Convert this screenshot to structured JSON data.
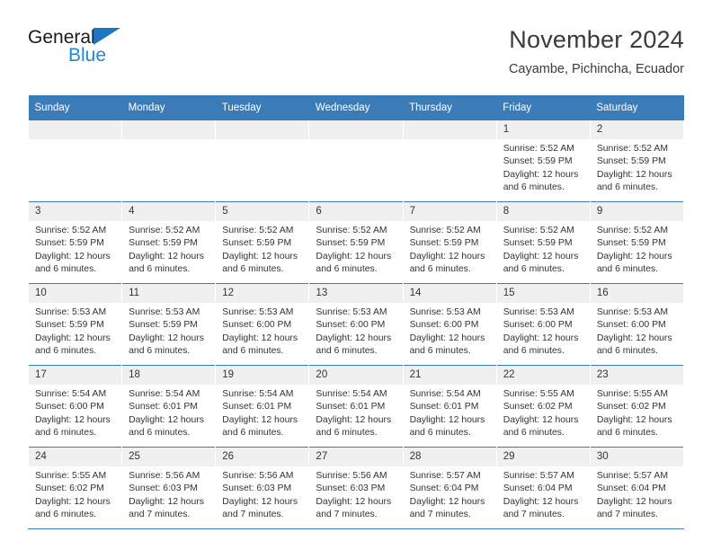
{
  "brand": {
    "name_top": "General",
    "name_bottom": "Blue",
    "triangle_icon": "brand-triangle-icon",
    "accent_color": "#1f76c0",
    "secondary_color": "#2287d6"
  },
  "header": {
    "title": "November 2024",
    "subtitle": "Cayambe, Pichincha, Ecuador"
  },
  "calendar": {
    "header_background": "#3b7cb8",
    "daynum_background": "#f0f0f0",
    "weekdays": [
      "Sunday",
      "Monday",
      "Tuesday",
      "Wednesday",
      "Thursday",
      "Friday",
      "Saturday"
    ],
    "labels": {
      "sunrise": "Sunrise:",
      "sunset": "Sunset:",
      "daylight": "Daylight:"
    },
    "weeks": [
      [
        {
          "day": "",
          "empty": true
        },
        {
          "day": "",
          "empty": true
        },
        {
          "day": "",
          "empty": true
        },
        {
          "day": "",
          "empty": true
        },
        {
          "day": "",
          "empty": true
        },
        {
          "day": "1",
          "sunrise": "Sunrise: 5:52 AM",
          "sunset": "Sunset: 5:59 PM",
          "daylight": "Daylight: 12 hours and 6 minutes."
        },
        {
          "day": "2",
          "sunrise": "Sunrise: 5:52 AM",
          "sunset": "Sunset: 5:59 PM",
          "daylight": "Daylight: 12 hours and 6 minutes."
        }
      ],
      [
        {
          "day": "3",
          "sunrise": "Sunrise: 5:52 AM",
          "sunset": "Sunset: 5:59 PM",
          "daylight": "Daylight: 12 hours and 6 minutes."
        },
        {
          "day": "4",
          "sunrise": "Sunrise: 5:52 AM",
          "sunset": "Sunset: 5:59 PM",
          "daylight": "Daylight: 12 hours and 6 minutes."
        },
        {
          "day": "5",
          "sunrise": "Sunrise: 5:52 AM",
          "sunset": "Sunset: 5:59 PM",
          "daylight": "Daylight: 12 hours and 6 minutes."
        },
        {
          "day": "6",
          "sunrise": "Sunrise: 5:52 AM",
          "sunset": "Sunset: 5:59 PM",
          "daylight": "Daylight: 12 hours and 6 minutes."
        },
        {
          "day": "7",
          "sunrise": "Sunrise: 5:52 AM",
          "sunset": "Sunset: 5:59 PM",
          "daylight": "Daylight: 12 hours and 6 minutes."
        },
        {
          "day": "8",
          "sunrise": "Sunrise: 5:52 AM",
          "sunset": "Sunset: 5:59 PM",
          "daylight": "Daylight: 12 hours and 6 minutes."
        },
        {
          "day": "9",
          "sunrise": "Sunrise: 5:52 AM",
          "sunset": "Sunset: 5:59 PM",
          "daylight": "Daylight: 12 hours and 6 minutes."
        }
      ],
      [
        {
          "day": "10",
          "sunrise": "Sunrise: 5:53 AM",
          "sunset": "Sunset: 5:59 PM",
          "daylight": "Daylight: 12 hours and 6 minutes."
        },
        {
          "day": "11",
          "sunrise": "Sunrise: 5:53 AM",
          "sunset": "Sunset: 5:59 PM",
          "daylight": "Daylight: 12 hours and 6 minutes."
        },
        {
          "day": "12",
          "sunrise": "Sunrise: 5:53 AM",
          "sunset": "Sunset: 6:00 PM",
          "daylight": "Daylight: 12 hours and 6 minutes."
        },
        {
          "day": "13",
          "sunrise": "Sunrise: 5:53 AM",
          "sunset": "Sunset: 6:00 PM",
          "daylight": "Daylight: 12 hours and 6 minutes."
        },
        {
          "day": "14",
          "sunrise": "Sunrise: 5:53 AM",
          "sunset": "Sunset: 6:00 PM",
          "daylight": "Daylight: 12 hours and 6 minutes."
        },
        {
          "day": "15",
          "sunrise": "Sunrise: 5:53 AM",
          "sunset": "Sunset: 6:00 PM",
          "daylight": "Daylight: 12 hours and 6 minutes."
        },
        {
          "day": "16",
          "sunrise": "Sunrise: 5:53 AM",
          "sunset": "Sunset: 6:00 PM",
          "daylight": "Daylight: 12 hours and 6 minutes."
        }
      ],
      [
        {
          "day": "17",
          "sunrise": "Sunrise: 5:54 AM",
          "sunset": "Sunset: 6:00 PM",
          "daylight": "Daylight: 12 hours and 6 minutes."
        },
        {
          "day": "18",
          "sunrise": "Sunrise: 5:54 AM",
          "sunset": "Sunset: 6:01 PM",
          "daylight": "Daylight: 12 hours and 6 minutes."
        },
        {
          "day": "19",
          "sunrise": "Sunrise: 5:54 AM",
          "sunset": "Sunset: 6:01 PM",
          "daylight": "Daylight: 12 hours and 6 minutes."
        },
        {
          "day": "20",
          "sunrise": "Sunrise: 5:54 AM",
          "sunset": "Sunset: 6:01 PM",
          "daylight": "Daylight: 12 hours and 6 minutes."
        },
        {
          "day": "21",
          "sunrise": "Sunrise: 5:54 AM",
          "sunset": "Sunset: 6:01 PM",
          "daylight": "Daylight: 12 hours and 6 minutes."
        },
        {
          "day": "22",
          "sunrise": "Sunrise: 5:55 AM",
          "sunset": "Sunset: 6:02 PM",
          "daylight": "Daylight: 12 hours and 6 minutes."
        },
        {
          "day": "23",
          "sunrise": "Sunrise: 5:55 AM",
          "sunset": "Sunset: 6:02 PM",
          "daylight": "Daylight: 12 hours and 6 minutes."
        }
      ],
      [
        {
          "day": "24",
          "sunrise": "Sunrise: 5:55 AM",
          "sunset": "Sunset: 6:02 PM",
          "daylight": "Daylight: 12 hours and 6 minutes."
        },
        {
          "day": "25",
          "sunrise": "Sunrise: 5:56 AM",
          "sunset": "Sunset: 6:03 PM",
          "daylight": "Daylight: 12 hours and 7 minutes."
        },
        {
          "day": "26",
          "sunrise": "Sunrise: 5:56 AM",
          "sunset": "Sunset: 6:03 PM",
          "daylight": "Daylight: 12 hours and 7 minutes."
        },
        {
          "day": "27",
          "sunrise": "Sunrise: 5:56 AM",
          "sunset": "Sunset: 6:03 PM",
          "daylight": "Daylight: 12 hours and 7 minutes."
        },
        {
          "day": "28",
          "sunrise": "Sunrise: 5:57 AM",
          "sunset": "Sunset: 6:04 PM",
          "daylight": "Daylight: 12 hours and 7 minutes."
        },
        {
          "day": "29",
          "sunrise": "Sunrise: 5:57 AM",
          "sunset": "Sunset: 6:04 PM",
          "daylight": "Daylight: 12 hours and 7 minutes."
        },
        {
          "day": "30",
          "sunrise": "Sunrise: 5:57 AM",
          "sunset": "Sunset: 6:04 PM",
          "daylight": "Daylight: 12 hours and 7 minutes."
        }
      ]
    ]
  }
}
